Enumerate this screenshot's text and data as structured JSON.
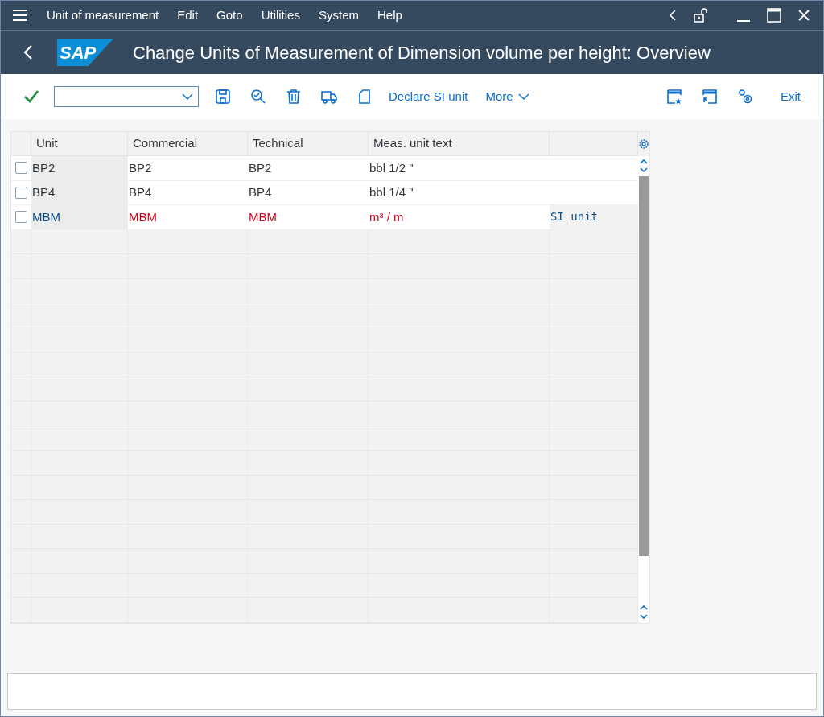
{
  "menu": [
    "Unit of measurement",
    "Edit",
    "Goto",
    "Utilities",
    "System",
    "Help"
  ],
  "logo": "SAP",
  "title": "Change Units of Measurement of Dimension volume per height: Overview",
  "toolbar": {
    "actions": [
      "Declare SI unit",
      "More"
    ],
    "exit": "Exit"
  },
  "table": {
    "columns": [
      "Unit",
      "Commercial",
      "Technical",
      "Meas. unit text"
    ],
    "rows": [
      {
        "checked": false,
        "highlighted": false,
        "cells": [
          "BP2",
          "BP2",
          "BP2",
          "bbl 1/2 \""
        ]
      },
      {
        "checked": false,
        "highlighted": false,
        "cells": [
          "BP4",
          "BP4",
          "BP4",
          "bbl 1/4 \""
        ]
      },
      {
        "checked": false,
        "highlighted": true,
        "cells": [
          "MBM",
          "MBM",
          "MBM",
          "m³ / m"
        ],
        "note": "SI unit"
      }
    ]
  }
}
